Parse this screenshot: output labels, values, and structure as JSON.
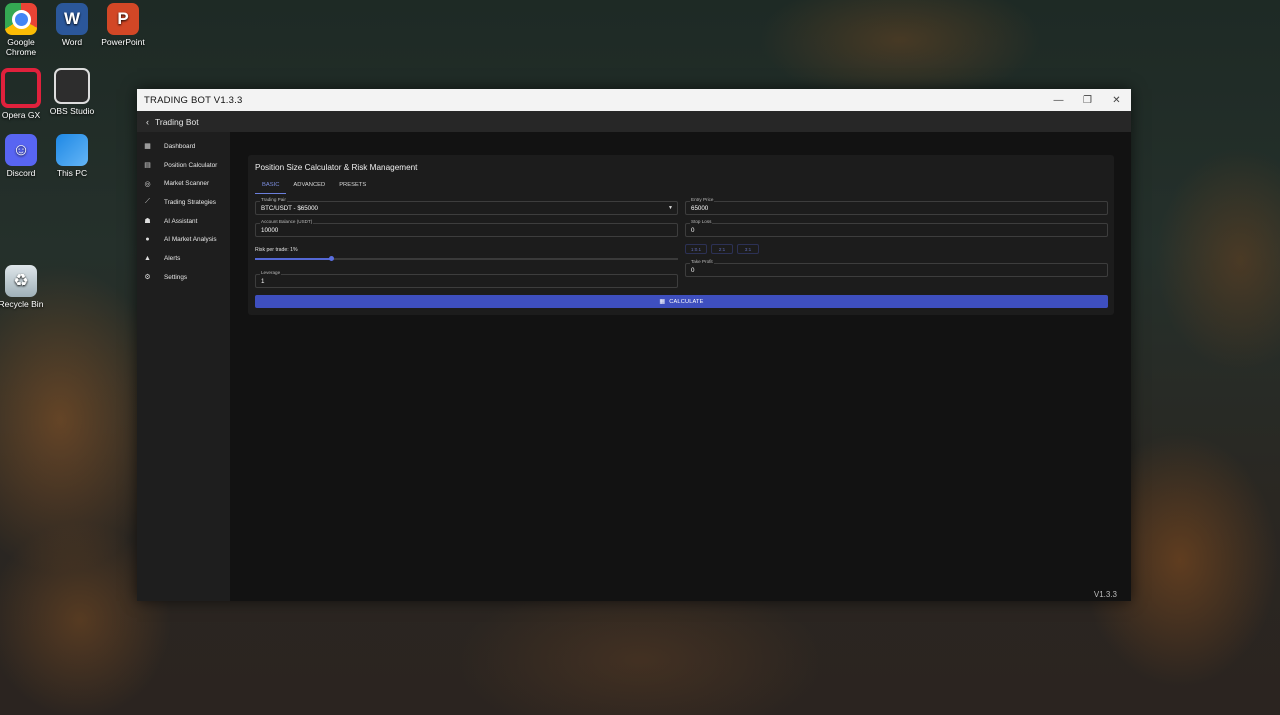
{
  "desktop": {
    "icons": [
      {
        "label": "Google\nChrome",
        "icon": "chrome-icon"
      },
      {
        "label": "Word",
        "icon": "word-icon"
      },
      {
        "label": "PowerPoint",
        "icon": "powerpoint-icon"
      },
      {
        "label": "Opera GX",
        "icon": "opera-gx-icon"
      },
      {
        "label": "OBS Studio",
        "icon": "obs-studio-icon"
      },
      {
        "label": "Discord",
        "icon": "discord-icon"
      },
      {
        "label": "This PC",
        "icon": "this-pc-icon"
      },
      {
        "label": "Recycle Bin",
        "icon": "recycle-bin-icon"
      }
    ]
  },
  "window": {
    "title": "TRADING BOT V1.3.3",
    "controls": {
      "minimize": "—",
      "restore": "❐",
      "close": "✕"
    }
  },
  "appbar": {
    "back_icon": "‹",
    "title": "Trading Bot"
  },
  "sidebar": {
    "items": [
      {
        "label": "Dashboard",
        "icon": "dashboard-icon"
      },
      {
        "label": "Position Calculator",
        "icon": "calculator-icon"
      },
      {
        "label": "Market Scanner",
        "icon": "scanner-icon"
      },
      {
        "label": "Trading Strategies",
        "icon": "strategies-icon"
      },
      {
        "label": "AI Assistant",
        "icon": "ai-assistant-icon"
      },
      {
        "label": "AI Market Analysis",
        "icon": "map-pin-icon"
      },
      {
        "label": "Alerts",
        "icon": "bell-icon"
      },
      {
        "label": "Settings",
        "icon": "gear-icon"
      }
    ]
  },
  "calculator": {
    "title": "Position Size Calculator & Risk Management",
    "tabs": [
      "BASIC",
      "ADVANCED",
      "PRESETS"
    ],
    "active_tab": "BASIC",
    "trading_pair": {
      "label": "Trading Pair",
      "value": "BTC/USDT - $65000"
    },
    "account_balance": {
      "label": "Account Balance (USDT)",
      "value": "10000"
    },
    "risk": {
      "label": "Risk per trade: 1%",
      "fraction": 0.18
    },
    "leverage": {
      "label": "Leverage",
      "value": "1"
    },
    "entry_price": {
      "label": "Entry Price",
      "value": "65000"
    },
    "stop_loss": {
      "label": "Stop Loss",
      "value": "0"
    },
    "ratio_buttons": [
      "1:0.1",
      "2:1",
      "3:1"
    ],
    "take_profit": {
      "label": "Take Profit",
      "value": "0"
    },
    "calculate_label": "CALCULATE"
  },
  "footer": {
    "version": "V1.3.3"
  },
  "colors": {
    "accent": "#3e4fbf",
    "tab_active": "#7d8fe0"
  }
}
